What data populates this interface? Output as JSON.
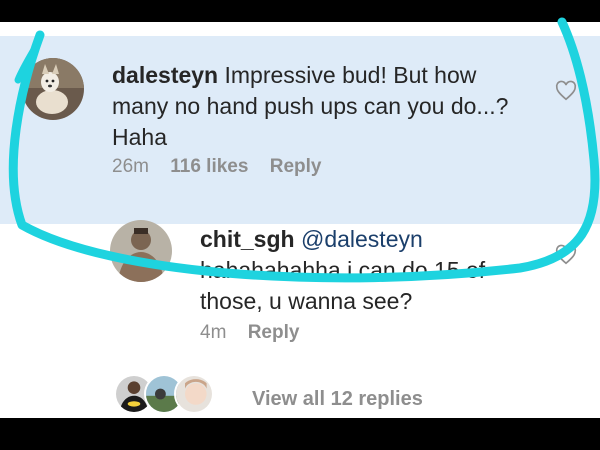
{
  "comment": {
    "username": "dalesteyn",
    "text": "Impressive bud! But how many no hand push ups can you do...? Haha",
    "time": "26m",
    "likes": "116 likes",
    "reply_label": "Reply",
    "avatar_icon": "dog-photo-avatar",
    "like_icon": "heart-outline-icon"
  },
  "reply": {
    "username": "chit_sgh",
    "mention": "@dalesteyn",
    "text": "hahahahahha i can do 15 of those, u wanna see?",
    "time": "4m",
    "reply_label": "Reply",
    "avatar_icon": "person-photo-avatar",
    "like_icon": "heart-outline-icon"
  },
  "replies_footer": {
    "label": "View all 12 replies",
    "avatar_icons": [
      "person-batman-shirt-avatar",
      "landscape-avatar",
      "face-avatar"
    ]
  },
  "colors": {
    "highlight_bg": "#deebf8",
    "scribble": "#1ed3df",
    "meta_text": "#8e8e8e"
  }
}
